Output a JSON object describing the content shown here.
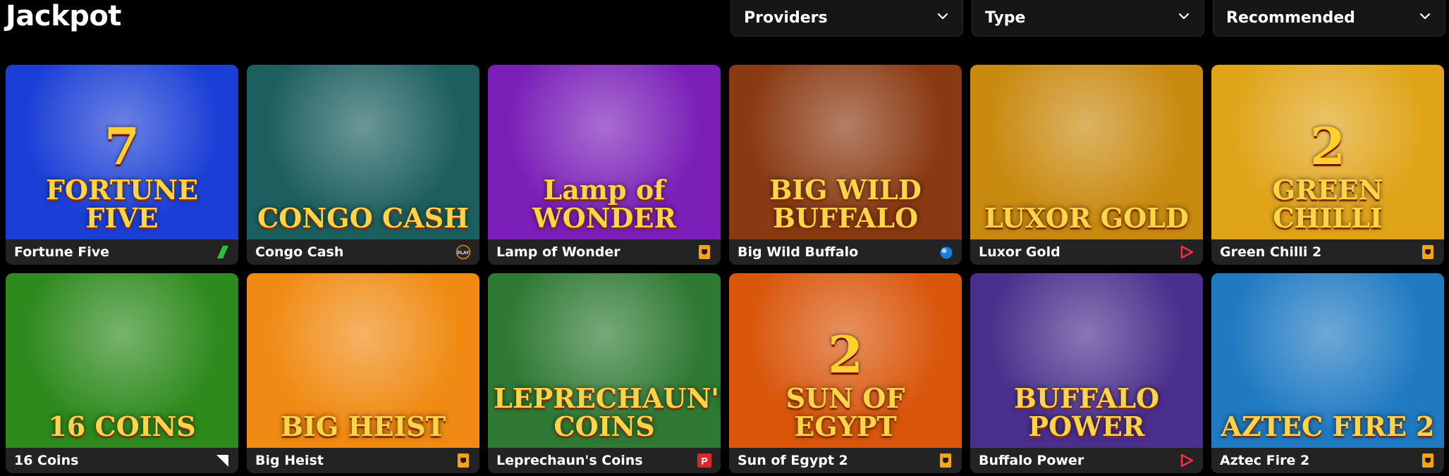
{
  "page": {
    "title": "Jackpot"
  },
  "filters": {
    "providers": "Providers",
    "type": "Type",
    "sort": "Recommended"
  },
  "games": [
    {
      "name": "Fortune Five",
      "art_text": "FORTUNE FIVE",
      "art_big": "7",
      "provider_icon": "green-slash-icon",
      "bg": "#1b3fd6"
    },
    {
      "name": "Congo Cash",
      "art_text": "CONGO CASH",
      "art_big": "",
      "provider_icon": "play-circle-icon",
      "bg": "#1d5f5f"
    },
    {
      "name": "Lamp of Wonder",
      "art_text": "Lamp of WONDER",
      "art_big": "",
      "provider_icon": "orange-shield-icon",
      "bg": "#7a1fb8"
    },
    {
      "name": "Big Wild Buffalo",
      "art_text": "BIG WILD BUFFALO",
      "art_big": "",
      "provider_icon": "blue-drop-icon",
      "bg": "#8a3a12"
    },
    {
      "name": "Luxor Gold",
      "art_text": "LUXOR GOLD",
      "art_big": "",
      "provider_icon": "red-play-icon",
      "bg": "#c98a10"
    },
    {
      "name": "Green Chilli 2",
      "art_text": "GREEN CHILLI",
      "art_big": "2",
      "provider_icon": "orange-shield-icon",
      "bg": "#e0a419"
    },
    {
      "name": "16 Coins",
      "art_text": "16 COINS",
      "art_big": "",
      "provider_icon": "white-corner-icon",
      "bg": "#2e8a1d"
    },
    {
      "name": "Big Heist",
      "art_text": "BIG HEIST",
      "art_big": "",
      "provider_icon": "orange-shield-icon",
      "bg": "#f08a12"
    },
    {
      "name": "Leprechaun's Coins",
      "art_text": "LEPRECHAUN'S COINS",
      "art_big": "",
      "provider_icon": "red-p-icon",
      "bg": "#2f7a33"
    },
    {
      "name": "Sun of Egypt 2",
      "art_text": "SUN OF EGYPT",
      "art_big": "2",
      "provider_icon": "orange-shield-icon",
      "bg": "#d9560b"
    },
    {
      "name": "Buffalo Power",
      "art_text": "BUFFALO POWER",
      "art_big": "",
      "provider_icon": "red-play-icon",
      "bg": "#4a2f8c"
    },
    {
      "name": "Aztec Fire 2",
      "art_text": "AZTEC FIRE 2",
      "art_big": "",
      "provider_icon": "orange-shield-icon",
      "bg": "#1f7ac2"
    }
  ],
  "colors": {
    "background": "#000000",
    "card_caption": "#232323",
    "dropdown_bg": "#161616"
  }
}
